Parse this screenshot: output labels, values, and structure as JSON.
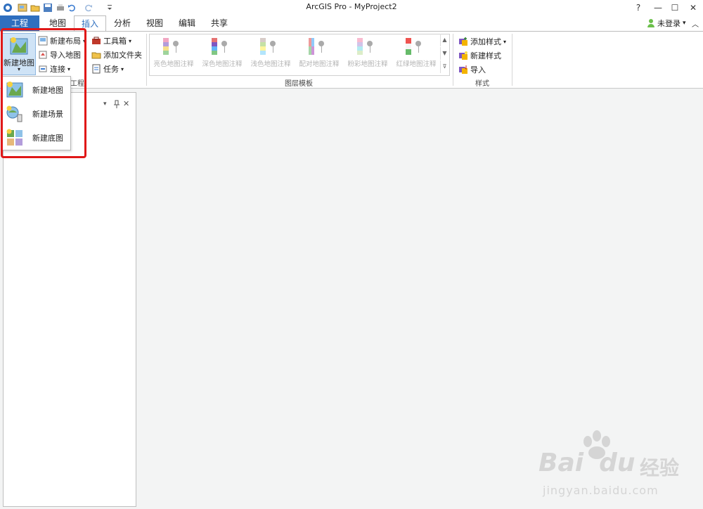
{
  "window": {
    "title": "ArcGIS Pro - MyProject2",
    "help": "?",
    "minimize": "—",
    "maximize": "☐",
    "close": "✕"
  },
  "tabs": [
    {
      "label": "工程"
    },
    {
      "label": "地图"
    },
    {
      "label": "插入"
    },
    {
      "label": "分析"
    },
    {
      "label": "视图"
    },
    {
      "label": "编辑"
    },
    {
      "label": "共享"
    }
  ],
  "account": {
    "label": "未登录",
    "chevron": "▾",
    "collapse": "︿"
  },
  "ribbon": {
    "project_group": {
      "label": "工程",
      "new_map": "新建地图",
      "new_layout": "新建布局",
      "import_map": "导入地图",
      "connect": "连接",
      "toolbox": "工具箱",
      "add_folder": "添加文件夹",
      "tasks": "任务"
    },
    "layer_templates": {
      "label": "图层模板",
      "items": [
        "亮色地图注释",
        "深色地图注释",
        "浅色地图注释",
        "配对地图注释",
        "粉彩地图注释",
        "红绿地图注释"
      ]
    },
    "styles": {
      "label": "样式",
      "add_style": "添加样式",
      "new_style": "新建样式",
      "import": "导入"
    }
  },
  "dropdown": {
    "items": [
      {
        "label": "新建地图",
        "icon": "map-icon"
      },
      {
        "label": "新建场景",
        "icon": "scene-icon"
      },
      {
        "label": "新建底图",
        "icon": "basemap-icon"
      }
    ]
  },
  "pane": {
    "pin": "📌",
    "menu": "▾",
    "close": "✕"
  },
  "watermark": {
    "brand": "Bai",
    "brand2": "du",
    "cn": "经验",
    "url": "jingyan.baidu.com"
  },
  "colors": {
    "accent": "#2f6fbf",
    "highlight": "#e01818"
  }
}
